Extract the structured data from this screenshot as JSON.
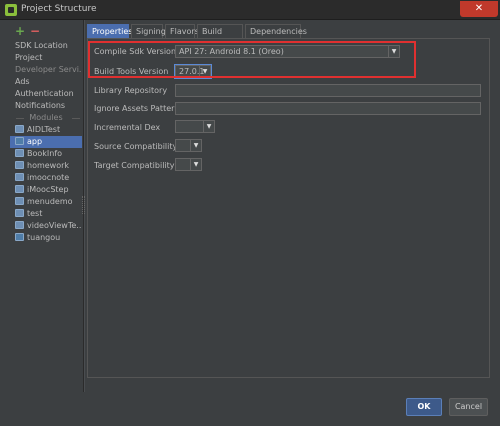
{
  "window": {
    "title": "Project Structure",
    "close_glyph": "✕"
  },
  "toolbar": {
    "add_glyph": "+",
    "remove_glyph": "−"
  },
  "sidebar": {
    "items": [
      "SDK Location",
      "Project",
      "Developer Servi...",
      "Ads",
      "Authentication",
      "Notifications"
    ],
    "modules_header": "Modules",
    "modules": [
      "AIDLTest",
      "app",
      "BookInfo",
      "homework",
      "imoocnote",
      "iMoocStep",
      "menudemo",
      "test",
      "videoViewTe...",
      "tuangou"
    ]
  },
  "tabs": [
    "Properties",
    "Signing",
    "Flavors",
    "Build Types",
    "Dependencies"
  ],
  "form": {
    "compile_sdk_label": "Compile Sdk Version",
    "compile_sdk_value": "API 27: Android 8.1 (Oreo)",
    "build_tools_label": "Build Tools Version",
    "build_tools_value": "27.0.1",
    "library_repo_label": "Library Repository",
    "ignore_assets_label": "Ignore Assets Pattern",
    "incremental_dex_label": "Incremental Dex",
    "source_compat_label": "Source Compatibility",
    "target_compat_label": "Target Compatibility",
    "dropdown_glyph": "▼"
  },
  "buttons": {
    "ok": "OK",
    "cancel": "Cancel"
  },
  "colors": {
    "background": "#3c3f41",
    "selection": "#4b6eaf",
    "highlight_box": "#e03030"
  }
}
